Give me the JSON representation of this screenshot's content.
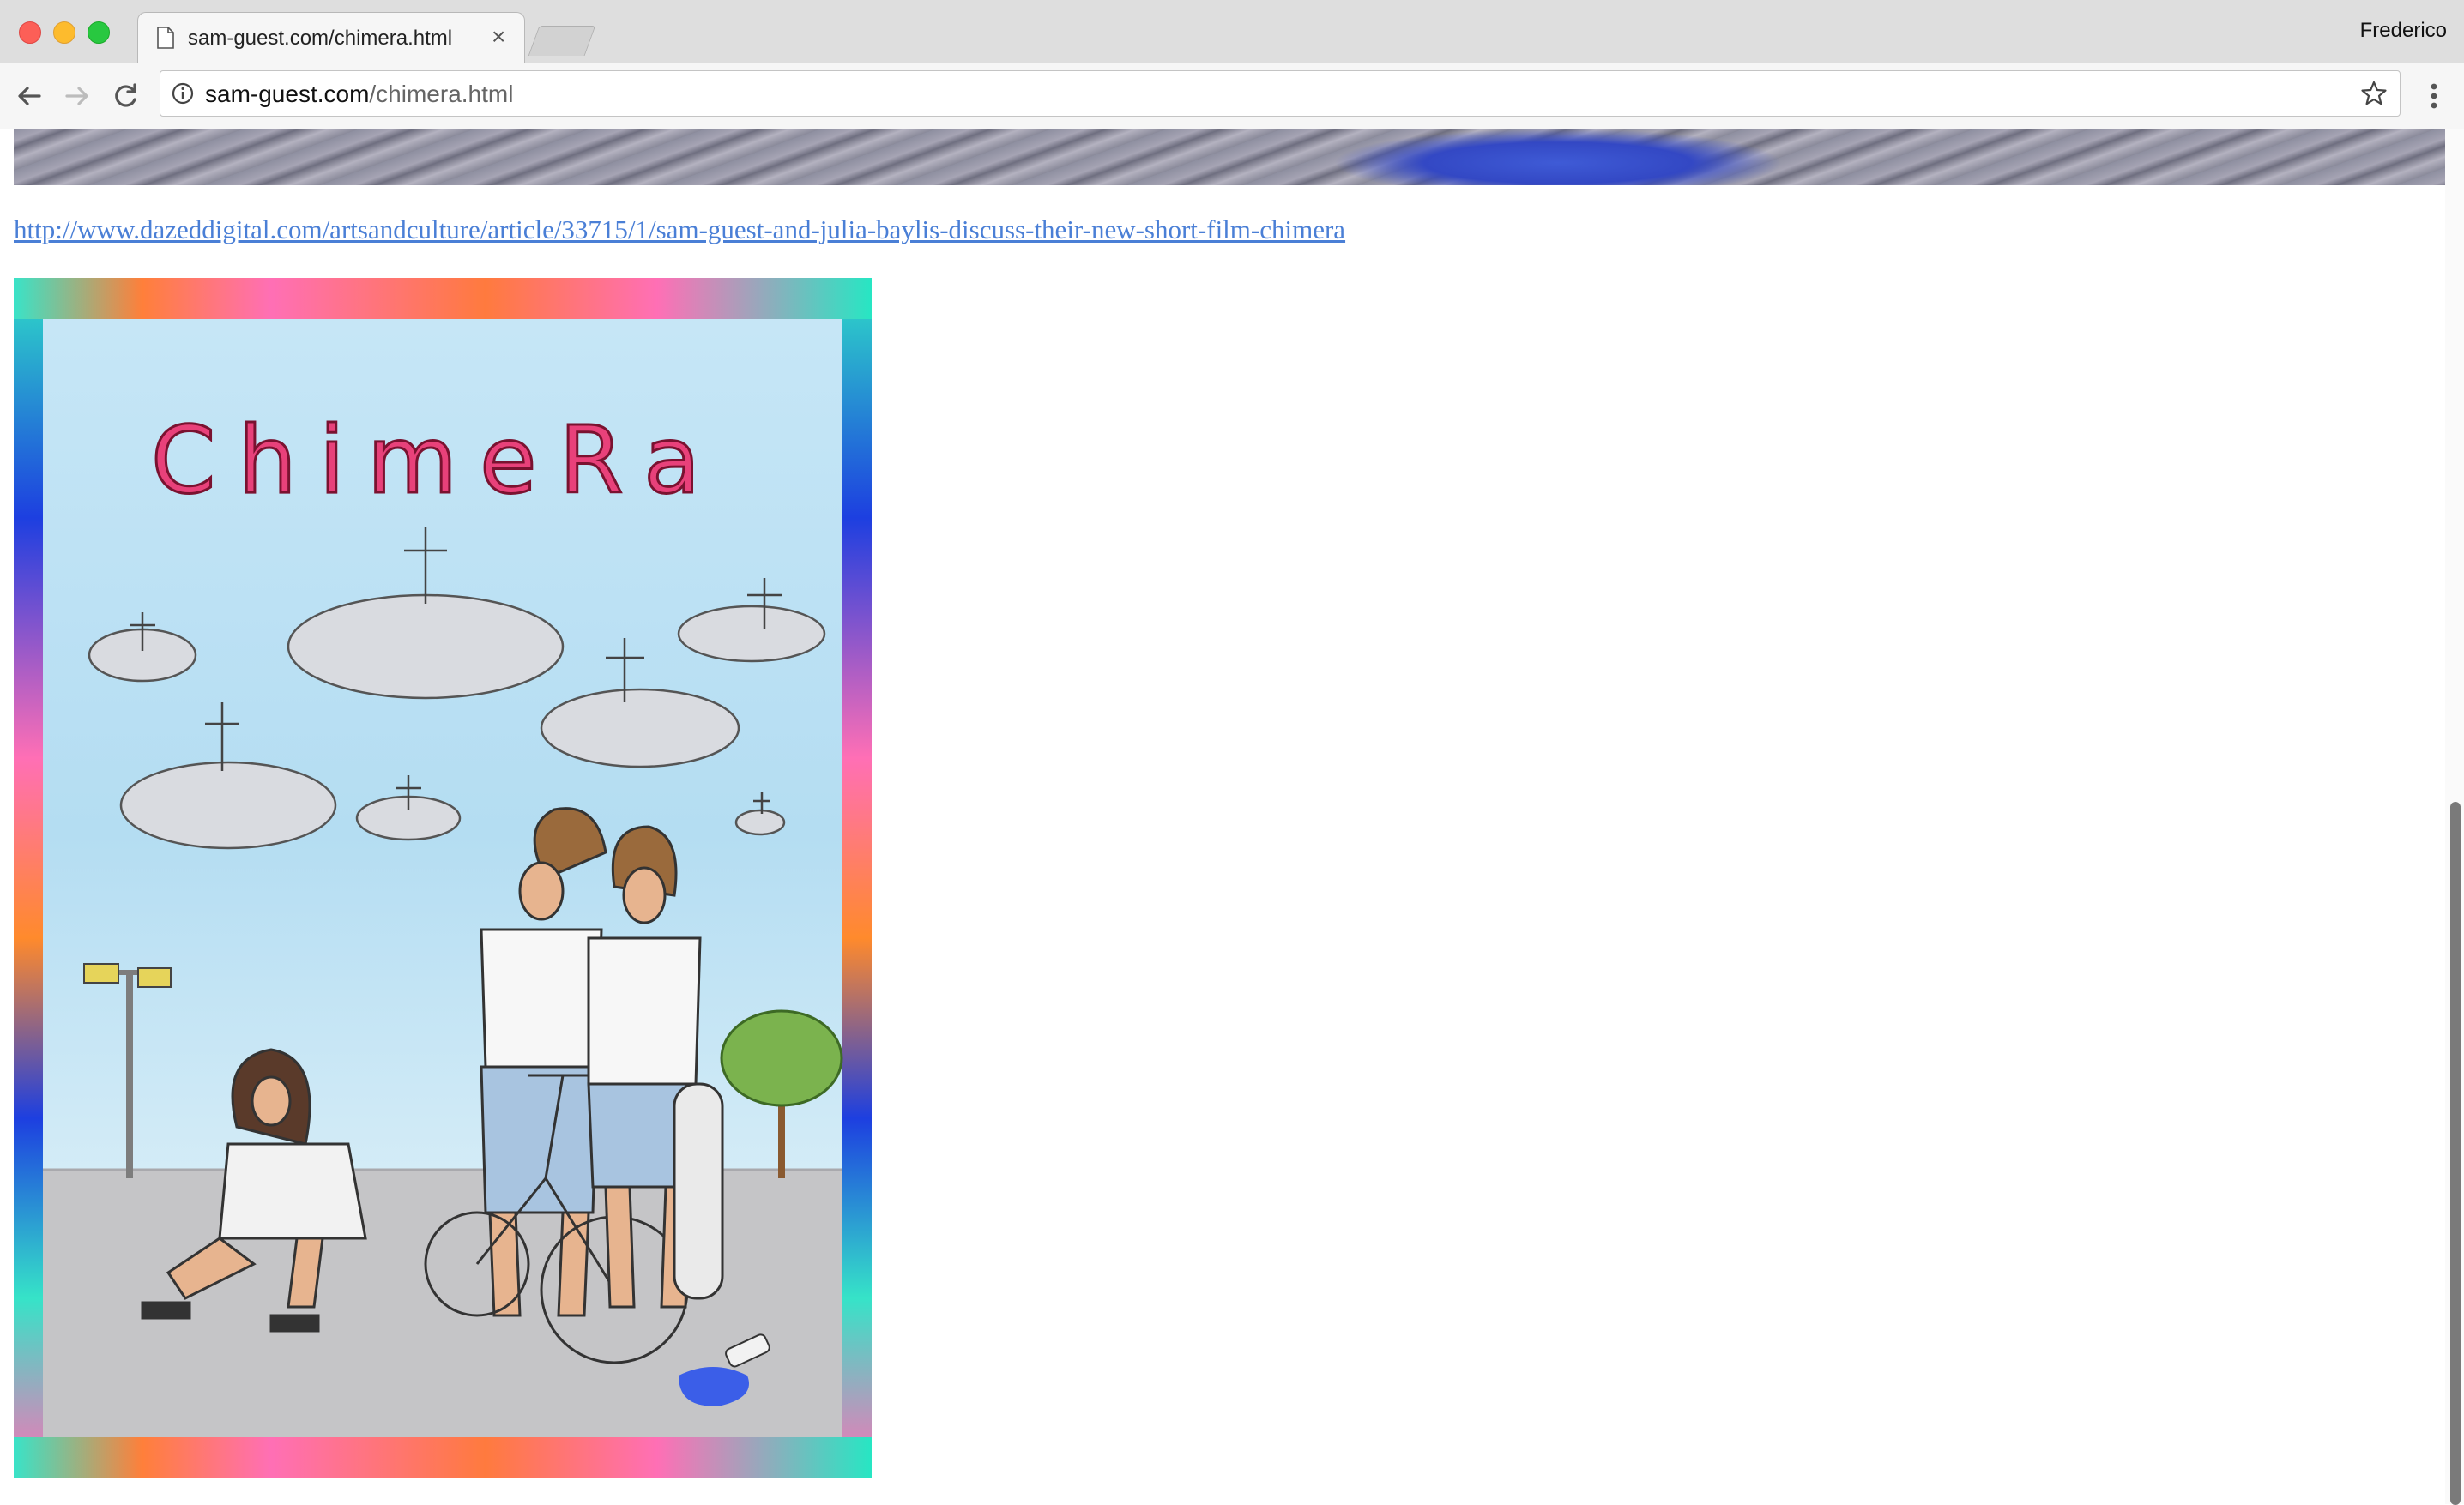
{
  "browser": {
    "tab_title": "sam-guest.com/chimera.html",
    "tab_close": "×",
    "profile_name": "Frederico",
    "url_host": "sam-guest.com",
    "url_path": "/chimera.html"
  },
  "page": {
    "article_link": "http://www.dazeddigital.com/artsandculture/article/33715/1/sam-guest-and-julia-baylis-discuss-their-new-short-film-chimera",
    "poster_title": "ChimeRa"
  },
  "colors": {
    "link": "#4a7fd6",
    "poster_title": "#e8417a"
  },
  "icons": [
    "page-icon",
    "close-icon",
    "back-arrow-icon",
    "forward-arrow-icon",
    "reload-icon",
    "info-icon",
    "star-icon",
    "kebab-menu-icon"
  ]
}
